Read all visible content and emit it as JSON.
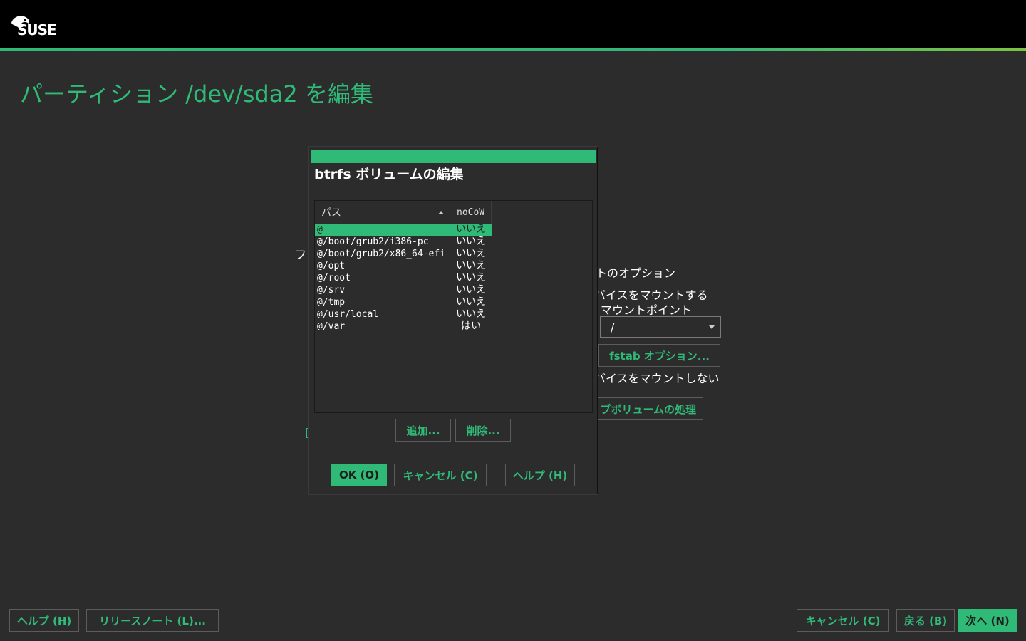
{
  "header": {
    "logo_text": "SUSE",
    "page_title": "パーティション /dev/sda2 を編集"
  },
  "background_form": {
    "label_fragment": "フ",
    "mount_options_heading": "トのオプション",
    "mount_device_option": "バイスをマウントする",
    "mount_point_label": "マウントポイント",
    "mount_point_value": "/",
    "fstab_button": "fstab オプション...",
    "do_not_mount_option": "バイスをマウントしない",
    "subvolume_button": "ブボリュームの処理"
  },
  "dialog": {
    "heading": "btrfs ボリュームの編集",
    "columns": {
      "path": "パス",
      "nocow": "noCoW"
    },
    "rows": [
      {
        "path": "@",
        "nocow": "いいえ",
        "selected": true
      },
      {
        "path": "@/boot/grub2/i386-pc",
        "nocow": "いいえ"
      },
      {
        "path": "@/boot/grub2/x86_64-efi",
        "nocow": "いいえ"
      },
      {
        "path": "@/opt",
        "nocow": "いいえ"
      },
      {
        "path": "@/root",
        "nocow": "いいえ"
      },
      {
        "path": "@/srv",
        "nocow": "いいえ"
      },
      {
        "path": "@/tmp",
        "nocow": "いいえ"
      },
      {
        "path": "@/usr/local",
        "nocow": "いいえ"
      },
      {
        "path": "@/var",
        "nocow": "はい"
      }
    ],
    "add_button": "追加...",
    "delete_button": "削除...",
    "ok_button": "OK (O)",
    "cancel_button": "キャンセル (C)",
    "help_button": "ヘルプ (H)"
  },
  "footer": {
    "help_button": "ヘルプ (H)",
    "release_notes_button": "リリースノート (L)...",
    "cancel_button": "キャンセル (C)",
    "back_button": "戻る (B)",
    "next_button": "次へ (N)"
  },
  "colors": {
    "accent": "#30ba78",
    "background": "#2c2c2c",
    "topbar": "#000000"
  }
}
